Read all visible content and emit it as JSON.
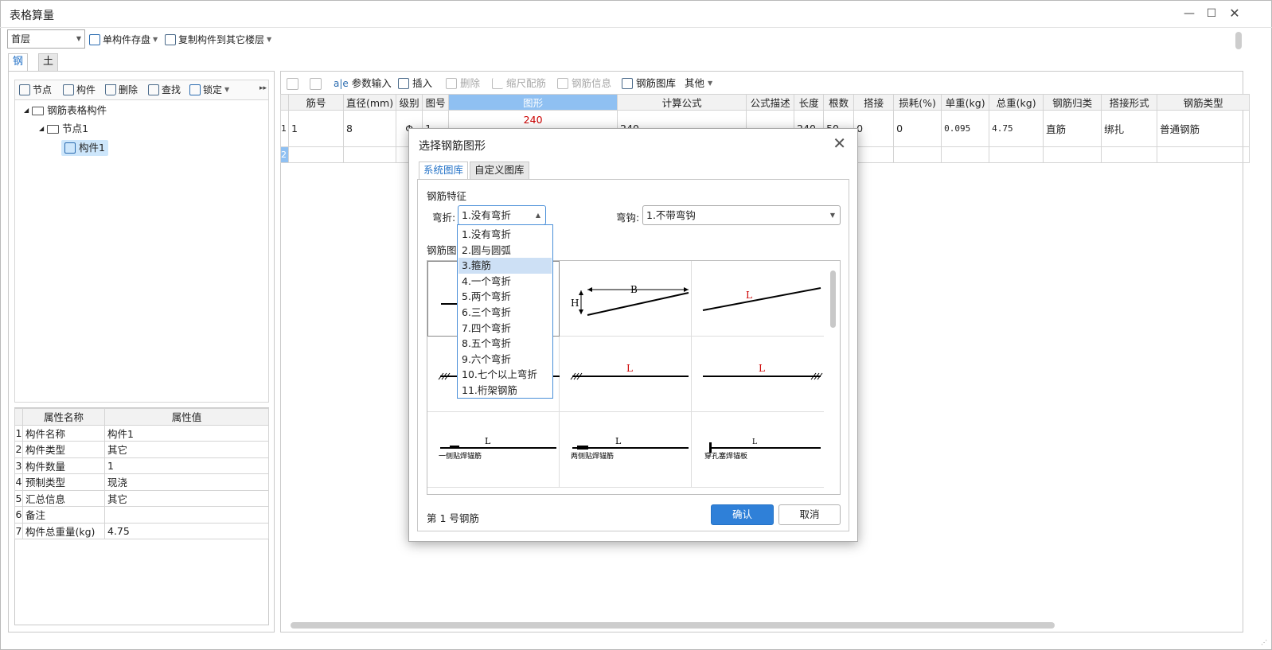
{
  "window": {
    "title": "表格算量"
  },
  "toolbar": {
    "floor_value": "首层",
    "save_component": "单构件存盘",
    "copy_to_floor": "复制构件到其它楼层"
  },
  "tabs": [
    "钢筋",
    "土建"
  ],
  "tree_toolbar": {
    "node": "节点",
    "component": "构件",
    "delete": "删除",
    "find": "查找",
    "lock": "锁定"
  },
  "tree": {
    "root": "钢筋表格构件",
    "node": "节点1",
    "component": "构件1"
  },
  "properties": {
    "headers": [
      "属性名称",
      "属性值"
    ],
    "rows": [
      {
        "n": "1",
        "name": "构件名称",
        "value": "构件1"
      },
      {
        "n": "2",
        "name": "构件类型",
        "value": "其它"
      },
      {
        "n": "3",
        "name": "构件数量",
        "value": "1"
      },
      {
        "n": "4",
        "name": "预制类型",
        "value": "现浇"
      },
      {
        "n": "5",
        "name": "汇总信息",
        "value": "其它"
      },
      {
        "n": "6",
        "name": "备注",
        "value": ""
      },
      {
        "n": "7",
        "name": "构件总重量(kg)",
        "value": "4.75"
      }
    ]
  },
  "grid_toolbar": {
    "param_input": "参数输入",
    "insert": "插入",
    "delete": "删除",
    "scale": "缩尺配筋",
    "info": "钢筋信息",
    "library": "钢筋图库",
    "other": "其他"
  },
  "grid": {
    "headers": [
      "筋号",
      "直径(mm)",
      "级别",
      "图号",
      "图形",
      "计算公式",
      "公式描述",
      "长度",
      "根数",
      "搭接",
      "损耗(%)",
      "单重(kg)",
      "总重(kg)",
      "钢筋归类",
      "搭接形式",
      "钢筋类型"
    ],
    "row1": {
      "n": "1",
      "bar_no": "1",
      "diameter": "8",
      "grade": "Φ",
      "fig_no": "1",
      "shape_value": "240",
      "formula": "240",
      "desc": "",
      "length": "240",
      "count": "50",
      "lap": "0",
      "loss": "0",
      "unit_weight": "0.095",
      "total_weight": "4.75",
      "category": "直筋",
      "lap_type": "绑扎",
      "bar_type": "普通钢筋"
    },
    "row2": {
      "n": "2"
    }
  },
  "dialog": {
    "title": "选择钢筋图形",
    "tabs": [
      "系统图库",
      "自定义图库"
    ],
    "feature_label": "钢筋特征",
    "bend_label": "弯折:",
    "bend_value": "1.没有弯折",
    "hook_label": "弯钩:",
    "hook_value": "1.不带弯钩",
    "gallery_label": "钢筋图形",
    "gallery": {
      "b_label": "B",
      "h_label": "H",
      "l_label": "L",
      "cap_one_side": "一侧贴焊锚筋",
      "cap_two_side": "两侧贴焊锚筋",
      "cap_plate": "穿孔塞焊锚板"
    },
    "status": "第 1 号钢筋",
    "ok": "确认",
    "cancel": "取消",
    "dropdown_options": [
      "1.没有弯折",
      "2.圆与圆弧",
      "3.箍筋",
      "4.一个弯折",
      "5.两个弯折",
      "6.三个弯折",
      "7.四个弯折",
      "8.五个弯折",
      "9.六个弯折",
      "10.七个以上弯折",
      "11.桁架钢筋"
    ],
    "dropdown_highlight": "3.箍筋"
  }
}
